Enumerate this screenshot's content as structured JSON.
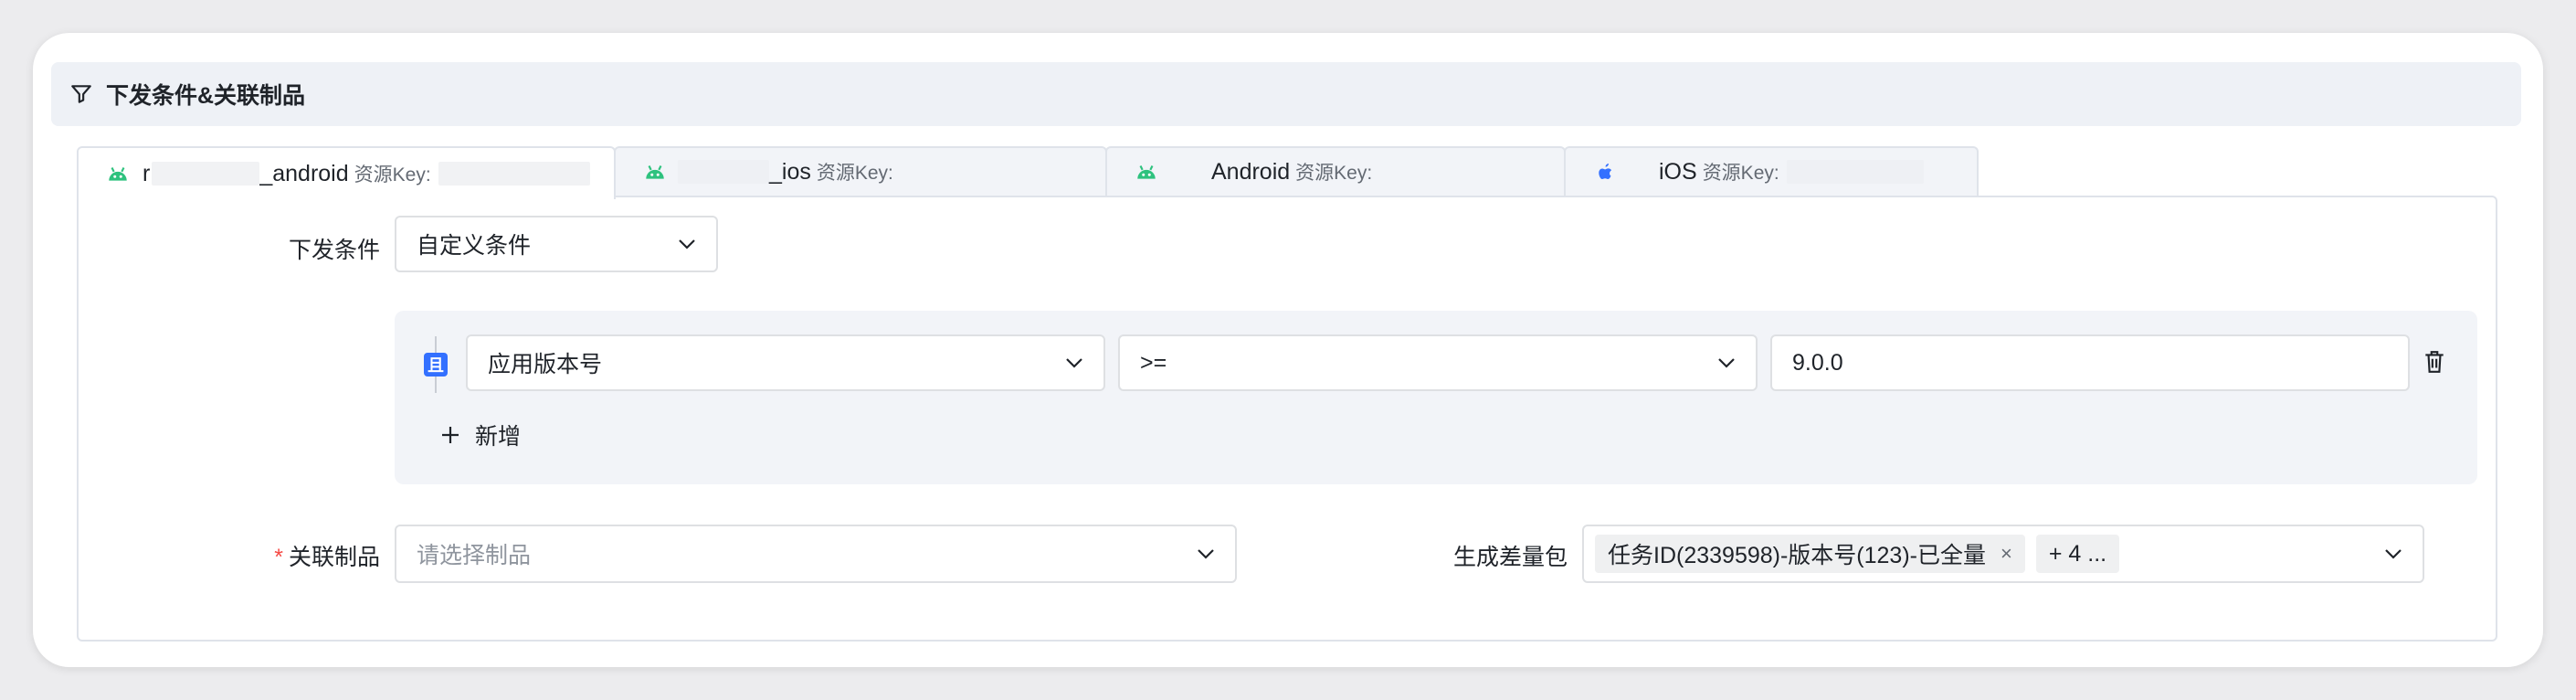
{
  "section": {
    "title": "下发条件&关联制品",
    "icon": "funnel-icon"
  },
  "tabs": [
    {
      "platform_icon": "android-icon",
      "name_prefix": "r",
      "name_suffix": "_android",
      "key_label": "资源Key:",
      "active": true
    },
    {
      "platform_icon": "android-icon",
      "name_prefix": "",
      "name_suffix": "_ios",
      "key_label": "资源Key:",
      "active": false
    },
    {
      "platform_icon": "android-icon",
      "name_prefix": "",
      "name_suffix": "Android",
      "key_label": "资源Key:",
      "active": false
    },
    {
      "platform_icon": "apple-icon",
      "name_prefix": "",
      "name_suffix": "iOS",
      "key_label": "资源Key:",
      "active": false
    }
  ],
  "form": {
    "condition_label": "下发条件",
    "condition_value": "自定义条件",
    "rule": {
      "logic": "且",
      "field": "应用版本号",
      "operator": ">=",
      "value": "9.0.0"
    },
    "add_label": "新增",
    "artifact_required": "*",
    "artifact_label": "关联制品",
    "artifact_placeholder": "请选择制品",
    "diff_label": "生成差量包",
    "diff_tag": "任务ID(2339598)-版本号(123)-已全量",
    "diff_tag_close": "×",
    "diff_more": "+ 4 ..."
  },
  "colors": {
    "accent": "#3370ff",
    "android": "#2ec27e",
    "apple": "#3370ff",
    "required": "#f54a45"
  }
}
